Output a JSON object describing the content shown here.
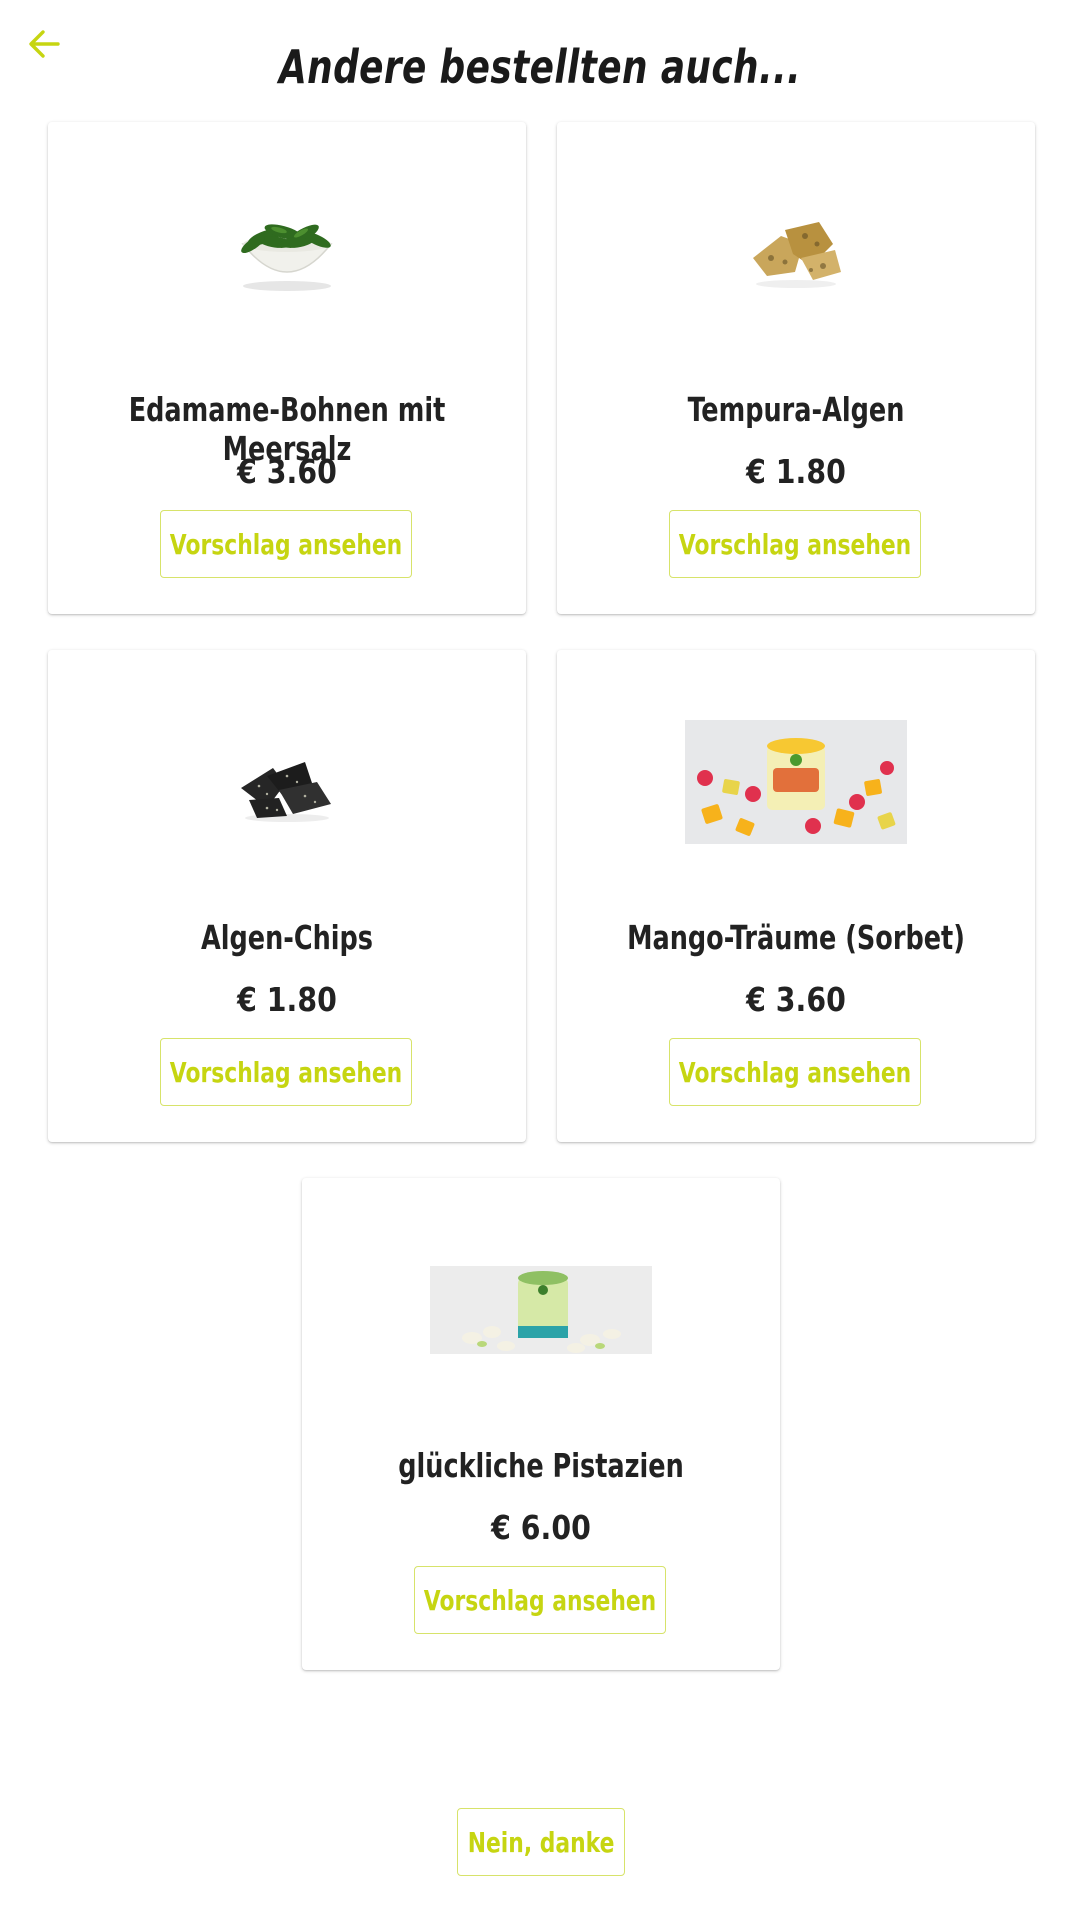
{
  "header": {
    "title": "Andere bestellten auch...",
    "back_icon": "arrow-left-icon",
    "accent_color": "#c6d511"
  },
  "suggestions": [
    {
      "name": "Edamame-Bohnen mit Meersalz",
      "price": "€ 3.60",
      "button_label": "Vorschlag ansehen",
      "image_icon": "edamame-bowl-image"
    },
    {
      "name": "Tempura-Algen",
      "price": "€ 1.80",
      "button_label": "Vorschlag ansehen",
      "image_icon": "tempura-seaweed-image"
    },
    {
      "name": "Algen-Chips",
      "price": "€ 1.80",
      "button_label": "Vorschlag ansehen",
      "image_icon": "seaweed-chips-image"
    },
    {
      "name": "Mango-Träume (Sorbet)",
      "price": "€ 3.60",
      "button_label": "Vorschlag ansehen",
      "image_icon": "mango-sorbet-image"
    },
    {
      "name": "glückliche Pistazien",
      "price": "€ 6.00",
      "button_label": "Vorschlag ansehen",
      "image_icon": "pistachio-icecream-image"
    }
  ],
  "footer": {
    "decline_label": "Nein, danke"
  }
}
